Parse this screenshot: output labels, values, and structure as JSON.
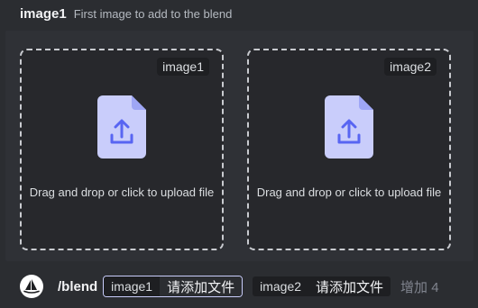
{
  "header": {
    "option_name": "image1",
    "option_description": "First image to add to the blend"
  },
  "dropzones": [
    {
      "tag": "image1",
      "text": "Drag and drop or click to upload file",
      "icon": "upload-file-icon"
    },
    {
      "tag": "image2",
      "text": "Drag and drop or click to upload file",
      "icon": "upload-file-icon"
    }
  ],
  "command": {
    "name": "/blend",
    "options": [
      {
        "label": "image1",
        "value": "请添加文件"
      },
      {
        "label": "image2",
        "value": "请添加文件"
      }
    ],
    "more_label": "增加 4"
  },
  "colors": {
    "icon_fill": "#c9cdfb",
    "icon_arrow": "#5865f2"
  }
}
